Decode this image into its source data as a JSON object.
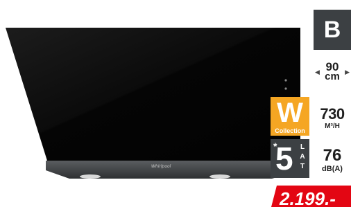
{
  "product": {
    "brand_logo": "Whirlpool"
  },
  "badges": {
    "energy_class": "B",
    "width": {
      "value": "90",
      "unit": "cm",
      "left_arrow": "◀",
      "right_arrow": "▶"
    },
    "collection": {
      "letter": "W",
      "label": "Collection"
    },
    "airflow": {
      "value": "730",
      "unit": "M³/H"
    },
    "warranty": {
      "star": "*",
      "years": "5",
      "letters": [
        "L",
        "A",
        "T"
      ]
    },
    "noise": {
      "value": "76",
      "unit": "dB(A)"
    }
  },
  "price": {
    "label": "2.199.-"
  },
  "colors": {
    "dark_badge": "#3c4043",
    "collection": "#f5a623",
    "price": "#e30613",
    "hood_glass": "#0a0a0a"
  }
}
